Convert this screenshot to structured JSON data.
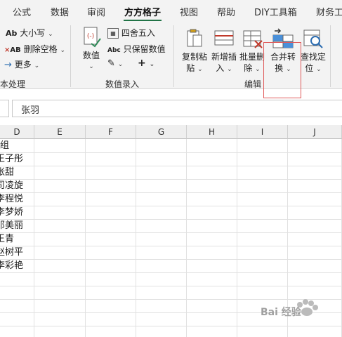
{
  "tabs": [
    {
      "label": "公式"
    },
    {
      "label": "数据"
    },
    {
      "label": "审阅"
    },
    {
      "label": "方方格子",
      "active": true
    },
    {
      "label": "视图"
    },
    {
      "label": "帮助"
    },
    {
      "label": "DIY工具箱"
    },
    {
      "label": "财务工"
    }
  ],
  "ribbon": {
    "text_group": {
      "case_label": "大小写",
      "delete_space_label": "删除空格",
      "more_label": "更多",
      "group_label": "本处理"
    },
    "number_group": {
      "value_label": "数值",
      "round_label": "四舍五入",
      "keep_numeric_label": "只保留数值",
      "group_label": "数值录入"
    },
    "edit_group": {
      "copy_paste_line1": "复制粘",
      "copy_paste_line2": "贴",
      "insert_line1": "新增插",
      "insert_line2": "入",
      "batch_delete_line1": "批量删",
      "batch_delete_line2": "除",
      "merge_convert_line1": "合并转",
      "merge_convert_line2": "换",
      "find_locate_line1": "查找定",
      "find_locate_line2": "位",
      "group_label": "编辑"
    }
  },
  "formula_bar": {
    "value": "张羽"
  },
  "columns": [
    "D",
    "E",
    "F",
    "G",
    "H",
    "I",
    "J"
  ],
  "column_d_cells": [
    "组",
    "王子彤",
    "张甜",
    "司凌旋",
    "李程悦",
    "李梦娇",
    "邓美丽",
    "王青",
    "赵树平",
    "李彩艳"
  ],
  "watermark": {
    "text": "Bai 经验"
  },
  "colors": {
    "accent": "#217346",
    "highlight": "#e05a5a"
  }
}
